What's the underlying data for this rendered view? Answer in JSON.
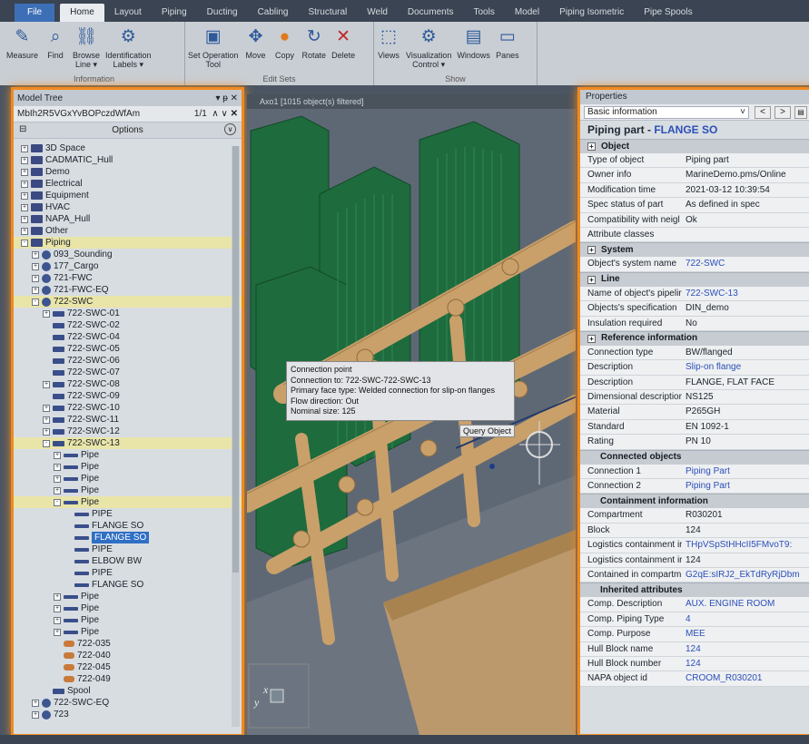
{
  "ribbon_tabs": [
    "File",
    "Home",
    "Layout",
    "Piping",
    "Ducting",
    "Cabling",
    "Structural",
    "Weld",
    "Documents",
    "Tools",
    "Model",
    "Piping Isometric",
    "Pipe Spools"
  ],
  "ribbon": {
    "information": {
      "label": "Information",
      "buttons": [
        "Measure",
        "Find",
        "Browse\nLine ▾",
        "Identification\nLabels ▾"
      ]
    },
    "edit_sets": {
      "label": "Edit Sets",
      "buttons": [
        "Set Operation\nTool",
        "Move",
        "Copy",
        "Rotate",
        "Delete"
      ]
    },
    "show": {
      "label": "Show",
      "buttons": [
        "Views",
        "Visualization\nControl ▾",
        "Windows",
        "Panes"
      ]
    }
  },
  "model_tree": {
    "title": "Model Tree",
    "search_value": "MbIh2R5VGxYvBOPczdWfAm",
    "match_count": "1/1",
    "options_label": "Options",
    "rows": [
      {
        "t": "3D Space",
        "lvl": 0,
        "ic": "folder",
        "exp": "+"
      },
      {
        "t": "CADMATIC_Hull",
        "lvl": 0,
        "ic": "folder",
        "exp": "+"
      },
      {
        "t": "Demo",
        "lvl": 0,
        "ic": "folder",
        "exp": "+"
      },
      {
        "t": "Electrical",
        "lvl": 0,
        "ic": "folder",
        "exp": "+"
      },
      {
        "t": "Equipment",
        "lvl": 0,
        "ic": "folder",
        "exp": "+"
      },
      {
        "t": "HVAC",
        "lvl": 0,
        "ic": "folder",
        "exp": "+"
      },
      {
        "t": "NAPA_Hull",
        "lvl": 0,
        "ic": "folder",
        "exp": "+"
      },
      {
        "t": "Other",
        "lvl": 0,
        "ic": "folder",
        "exp": "+"
      },
      {
        "t": "Piping",
        "lvl": 0,
        "ic": "folder",
        "exp": "-",
        "hl": true
      },
      {
        "t": "093_Sounding",
        "lvl": 1,
        "ic": "pipesys",
        "exp": "+"
      },
      {
        "t": "177_Cargo",
        "lvl": 1,
        "ic": "pipesys",
        "exp": "+"
      },
      {
        "t": "721-FWC",
        "lvl": 1,
        "ic": "pipesys",
        "exp": "+"
      },
      {
        "t": "721-FWC-EQ",
        "lvl": 1,
        "ic": "pipesys",
        "exp": "+"
      },
      {
        "t": "722-SWC",
        "lvl": 1,
        "ic": "pipesys",
        "exp": "-",
        "hl": true
      },
      {
        "t": "722-SWC-01",
        "lvl": 2,
        "ic": "line",
        "exp": "+"
      },
      {
        "t": "722-SWC-02",
        "lvl": 2,
        "ic": "line",
        "exp": ""
      },
      {
        "t": "722-SWC-04",
        "lvl": 2,
        "ic": "line",
        "exp": ""
      },
      {
        "t": "722-SWC-05",
        "lvl": 2,
        "ic": "line",
        "exp": ""
      },
      {
        "t": "722-SWC-06",
        "lvl": 2,
        "ic": "line",
        "exp": ""
      },
      {
        "t": "722-SWC-07",
        "lvl": 2,
        "ic": "line",
        "exp": ""
      },
      {
        "t": "722-SWC-08",
        "lvl": 2,
        "ic": "line",
        "exp": "+"
      },
      {
        "t": "722-SWC-09",
        "lvl": 2,
        "ic": "line",
        "exp": ""
      },
      {
        "t": "722-SWC-10",
        "lvl": 2,
        "ic": "line",
        "exp": "+"
      },
      {
        "t": "722-SWC-11",
        "lvl": 2,
        "ic": "line",
        "exp": "+"
      },
      {
        "t": "722-SWC-12",
        "lvl": 2,
        "ic": "line",
        "exp": "+"
      },
      {
        "t": "722-SWC-13",
        "lvl": 2,
        "ic": "line",
        "exp": "-",
        "hl": true
      },
      {
        "t": "Pipe",
        "lvl": 3,
        "ic": "pipe",
        "exp": "+"
      },
      {
        "t": "Pipe",
        "lvl": 3,
        "ic": "pipe",
        "exp": "+"
      },
      {
        "t": "Pipe",
        "lvl": 3,
        "ic": "pipe",
        "exp": "+"
      },
      {
        "t": "Pipe",
        "lvl": 3,
        "ic": "pipe",
        "exp": "+"
      },
      {
        "t": "Pipe",
        "lvl": 3,
        "ic": "pipe",
        "exp": "-",
        "hl": true
      },
      {
        "t": "PIPE",
        "lvl": 4,
        "ic": "pipe",
        "exp": ""
      },
      {
        "t": "FLANGE SO",
        "lvl": 4,
        "ic": "pipe",
        "exp": ""
      },
      {
        "t": "FLANGE SO",
        "lvl": 4,
        "ic": "pipe",
        "exp": "",
        "sel": true
      },
      {
        "t": "PIPE",
        "lvl": 4,
        "ic": "pipe",
        "exp": ""
      },
      {
        "t": "ELBOW BW",
        "lvl": 4,
        "ic": "pipe",
        "exp": ""
      },
      {
        "t": "PIPE",
        "lvl": 4,
        "ic": "pipe",
        "exp": ""
      },
      {
        "t": "FLANGE SO",
        "lvl": 4,
        "ic": "pipe",
        "exp": ""
      },
      {
        "t": "Pipe",
        "lvl": 3,
        "ic": "pipe",
        "exp": "+"
      },
      {
        "t": "Pipe",
        "lvl": 3,
        "ic": "pipe",
        "exp": "+"
      },
      {
        "t": "Pipe",
        "lvl": 3,
        "ic": "pipe",
        "exp": "+"
      },
      {
        "t": "Pipe",
        "lvl": 3,
        "ic": "pipe",
        "exp": "+"
      },
      {
        "t": "722-035",
        "lvl": 3,
        "ic": "comp",
        "exp": ""
      },
      {
        "t": "722-040",
        "lvl": 3,
        "ic": "comp",
        "exp": ""
      },
      {
        "t": "722-045",
        "lvl": 3,
        "ic": "comp",
        "exp": ""
      },
      {
        "t": "722-049",
        "lvl": 3,
        "ic": "comp",
        "exp": ""
      },
      {
        "t": "Spool",
        "lvl": 2,
        "ic": "line",
        "exp": ""
      },
      {
        "t": "722-SWC-EQ",
        "lvl": 1,
        "ic": "pipesys",
        "exp": "+"
      },
      {
        "t": "723",
        "lvl": 1,
        "ic": "pipesys",
        "exp": "+"
      }
    ]
  },
  "viewport": {
    "title": "Axo1   [1015 object(s) filtered]",
    "tooltip": [
      "Connection point",
      "Connection to: 722-SWC-722-SWC-13",
      "Primary face type: Welded connection for slip-on flanges",
      "Flow direction: Out",
      "Nominal size: 125"
    ],
    "query_label": "Query Object"
  },
  "properties": {
    "title": "Properties",
    "selector": "Basic information",
    "part_type": "Piping part - ",
    "part_name": "FLANGE SO",
    "sections": [
      {
        "name": "Object",
        "box": true,
        "rows": [
          [
            "Type of object",
            "Piping part",
            false
          ],
          [
            "Owner info",
            "MarineDemo.pms/Online",
            false
          ],
          [
            "Modification time",
            "2021-03-12 10:39:54",
            false
          ],
          [
            "Spec status of part",
            "As defined in spec",
            false
          ],
          [
            "Compatibility with neigl",
            "Ok",
            false
          ],
          [
            "Attribute classes",
            "",
            false
          ]
        ]
      },
      {
        "name": "System",
        "box": true,
        "rows": [
          [
            "Object's system name",
            "722-SWC",
            true
          ]
        ]
      },
      {
        "name": "Line",
        "box": true,
        "rows": [
          [
            "Name of object's pipelir",
            "722-SWC-13",
            true
          ],
          [
            "Objects's specification",
            "DIN_demo",
            false
          ],
          [
            "Insulation required",
            "No",
            false
          ]
        ]
      },
      {
        "name": "Reference information",
        "box": true,
        "rows": [
          [
            "Connection type",
            "BW/flanged",
            false
          ],
          [
            "Description",
            "Slip-on flange",
            true
          ],
          [
            "Description",
            "FLANGE, FLAT FACE",
            false
          ],
          [
            "Dimensional descriptior",
            "NS125",
            false
          ],
          [
            "Material",
            "P265GH",
            false
          ],
          [
            "Standard",
            "EN 1092-1",
            false
          ],
          [
            "Rating",
            "PN 10",
            false
          ]
        ]
      },
      {
        "name": "Connected objects",
        "box": false,
        "rows": [
          [
            "Connection 1",
            "Piping Part",
            true
          ],
          [
            "Connection 2",
            "Piping Part",
            true
          ]
        ]
      },
      {
        "name": "Containment information",
        "box": false,
        "rows": [
          [
            "Compartment",
            "R030201",
            false
          ],
          [
            "Block",
            "124",
            false
          ],
          [
            "Logistics containment ir",
            "THpVSpStHHcII5FMvoT9:",
            true
          ],
          [
            "Logistics containment ir",
            "124",
            false
          ],
          [
            "Contained in compartm",
            "G2qE:sIRJ2_EkTdRyRjDbm",
            true
          ]
        ]
      },
      {
        "name": "Inherited attributes",
        "box": false,
        "rows": [
          [
            "Comp. Description",
            "AUX. ENGINE ROOM",
            true
          ],
          [
            "Comp. Piping Type",
            "4",
            true
          ],
          [
            "Comp. Purpose",
            "MEE",
            true
          ],
          [
            "Hull Block name",
            "124",
            true
          ],
          [
            "Hull Block number",
            "124",
            true
          ],
          [
            "NAPA object id",
            "CROOM_R030201",
            true
          ]
        ]
      }
    ]
  }
}
